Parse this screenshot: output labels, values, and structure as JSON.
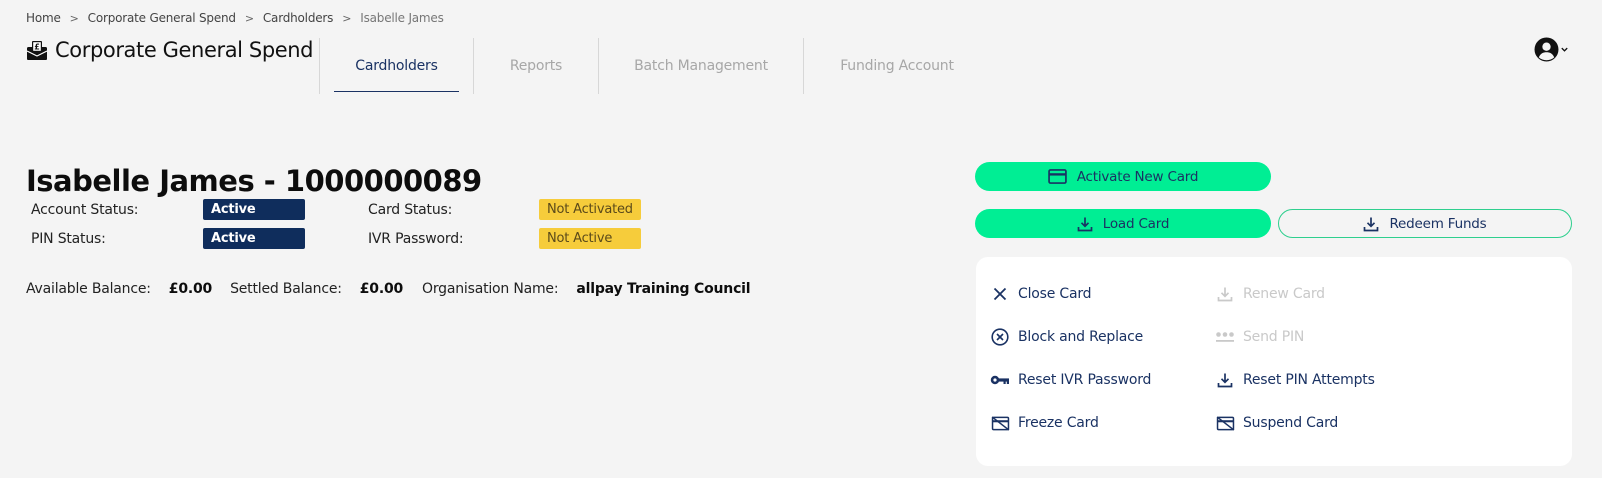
{
  "breadcrumb": [
    {
      "label": "Home"
    },
    {
      "label": "Corporate General Spend"
    },
    {
      "label": "Cardholders"
    },
    {
      "label": "Isabelle James"
    }
  ],
  "app": {
    "title": "Corporate General Spend",
    "logo_icon": "wallet-pound-icon"
  },
  "tabs": [
    {
      "label": "Cardholders",
      "active": true
    },
    {
      "label": "Reports"
    },
    {
      "label": "Batch Management"
    },
    {
      "label": "Funding Account"
    }
  ],
  "profile": {
    "icon": "user-circle-icon"
  },
  "cardholder": {
    "heading": "Isabelle James - 1000000089",
    "account_status_label": "Account Status:",
    "account_status": "Active",
    "card_status_label": "Card Status:",
    "card_status": "Not Activated",
    "pin_status_label": "PIN Status:",
    "pin_status": "Active",
    "ivr_password_label": "IVR Password:",
    "ivr_password": "Not Active",
    "available_balance_label": "Available Balance:",
    "available_balance": "£0.00",
    "settled_balance_label": "Settled Balance:",
    "settled_balance": "£0.00",
    "organisation_label": "Organisation Name:",
    "organisation": "allpay Training Council"
  },
  "buttons": {
    "activate_new_card": "Activate New Card",
    "load_card": "Load Card",
    "redeem_funds": "Redeem Funds"
  },
  "actions": {
    "close_card": "Close Card",
    "renew_card": "Renew Card",
    "block_and_replace": "Block and Replace",
    "send_pin": "Send PIN",
    "reset_ivr_password": "Reset IVR Password",
    "reset_pin_attempts": "Reset PIN Attempts",
    "freeze_card": "Freeze Card",
    "suspend_card": "Suspend Card"
  },
  "colors": {
    "brand_navy": "#1a3263",
    "accent_green": "#00ee94",
    "warn_yellow": "#f6cc3b",
    "disabled": "#c9c9c9"
  }
}
